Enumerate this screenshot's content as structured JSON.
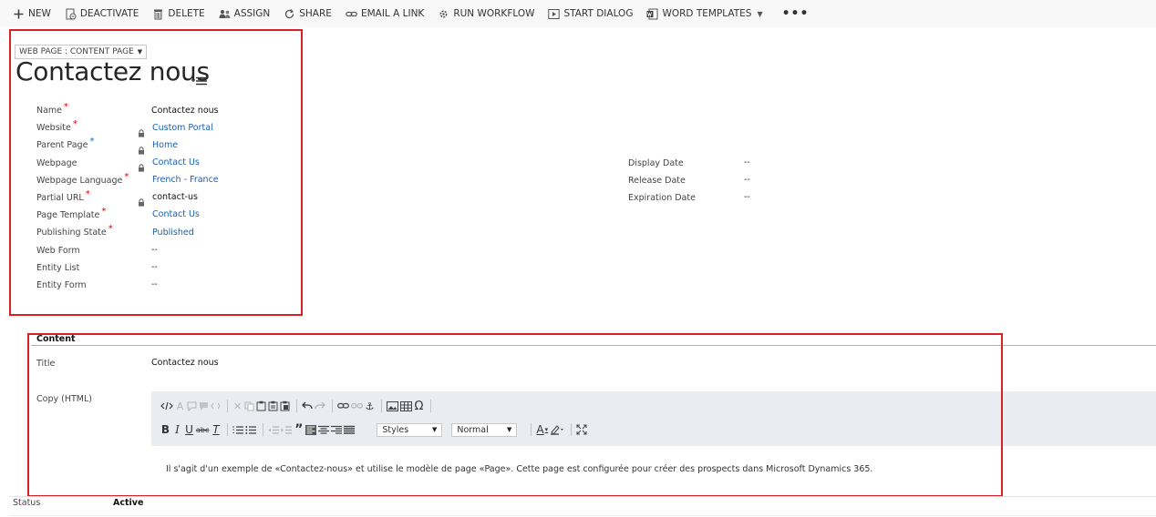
{
  "command_bar": {
    "new": "NEW",
    "deactivate": "DEACTIVATE",
    "delete": "DELETE",
    "assign": "ASSIGN",
    "share": "SHARE",
    "email_link": "EMAIL A LINK",
    "run_workflow": "RUN WORKFLOW",
    "start_dialog": "START DIALOG",
    "word_templates": "WORD TEMPLATES",
    "more": "•••"
  },
  "header": {
    "entity_form_selector": "WEB PAGE : CONTENT PAGE",
    "record_title": "Contactez nous"
  },
  "general": {
    "fields": {
      "name": {
        "label": "Name",
        "value": "Contactez nous"
      },
      "website": {
        "label": "Website",
        "value": "Custom Portal"
      },
      "parent_page": {
        "label": "Parent Page",
        "value": "Home"
      },
      "webpage": {
        "label": "Webpage",
        "value": "Contact Us"
      },
      "webpage_language": {
        "label": "Webpage Language",
        "value": "French - France"
      },
      "partial_url": {
        "label": "Partial URL",
        "value": "contact-us"
      },
      "page_template": {
        "label": "Page Template",
        "value": "Contact Us"
      },
      "publishing_state": {
        "label": "Publishing State",
        "value": "Published"
      },
      "web_form": {
        "label": "Web Form",
        "value": "--"
      },
      "entity_list": {
        "label": "Entity List",
        "value": "--"
      },
      "entity_form": {
        "label": "Entity Form",
        "value": "--"
      }
    },
    "dates": {
      "display_date": {
        "label": "Display Date",
        "value": "--"
      },
      "release_date": {
        "label": "Release Date",
        "value": "--"
      },
      "expiration_date": {
        "label": "Expiration Date",
        "value": "--"
      }
    }
  },
  "content_section": {
    "title": "Content",
    "title_field": {
      "label": "Title",
      "value": "Contactez nous"
    },
    "copy_field": {
      "label": "Copy (HTML)"
    },
    "editor": {
      "styles_value": "Styles",
      "format_value": "Normal",
      "body_text": "Il s'agit d'un exemple de «Contactez-nous» et utilise le modèle de page «Page». Cette page est configurée pour créer des prospects dans Microsoft Dynamics 365."
    }
  },
  "footer": {
    "status_label": "Status",
    "status_value": "Active"
  },
  "colors": {
    "annotation_border": "#d72027",
    "link": "#1760b3",
    "required_asterisk": "#e00000",
    "recommended_asterisk": "#1560bd",
    "editor_toolbar_bg": "#e9edf2"
  }
}
